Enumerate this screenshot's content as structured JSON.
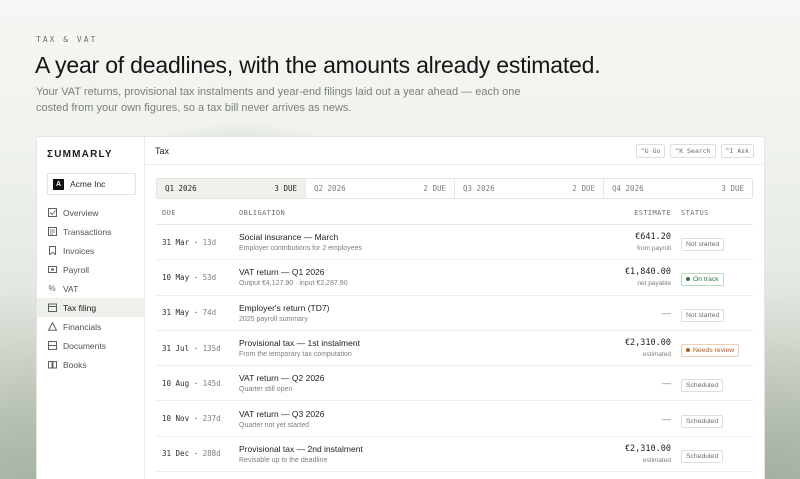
{
  "eyebrow": "TAX & VAT",
  "headline": "A year of deadlines, with the amounts already estimated.",
  "subtitle": "Your VAT returns, provisional tax instalments and year-end filings laid out a year ahead — each one costed from your own figures, so a tax bill never arrives as news.",
  "app": {
    "brand": "ΣUMMARLY",
    "org": {
      "badge": "A",
      "name": "Acme Inc"
    },
    "nav": [
      {
        "label": "Overview",
        "icon": "checkbox-icon"
      },
      {
        "label": "Transactions",
        "icon": "list-icon"
      },
      {
        "label": "Invoices",
        "icon": "bookmark-icon"
      },
      {
        "label": "Payroll",
        "icon": "wallet-icon"
      },
      {
        "label": "VAT",
        "icon": "percent-icon"
      },
      {
        "label": "Tax filing",
        "icon": "calendar-icon",
        "active": true
      },
      {
        "label": "Financials",
        "icon": "triangle-icon"
      },
      {
        "label": "Documents",
        "icon": "stack-icon"
      },
      {
        "label": "Books",
        "icon": "book-icon"
      }
    ],
    "topbar": {
      "title": "Tax",
      "shortcuts": [
        "^G Go",
        "^K Search",
        "^I Ask"
      ]
    },
    "quarters": [
      {
        "label": "Q1 2026",
        "count": "3 DUE",
        "active": true
      },
      {
        "label": "Q2 2026",
        "count": "2 DUE"
      },
      {
        "label": "Q3 2026",
        "count": "2 DUE"
      },
      {
        "label": "Q4 2026",
        "count": "3 DUE"
      }
    ],
    "columns": {
      "due": "DUE",
      "obligation": "OBLIGATION",
      "estimate": "ESTIMATE",
      "status": "STATUS"
    },
    "rows": [
      {
        "due": "31 Mar",
        "days": "13d",
        "title": "Social insurance — March",
        "sub": "Employer contributions for 2 employees",
        "amount": "€641.20",
        "note": "from payroll",
        "status": "Not started",
        "tone": "neutral"
      },
      {
        "due": "10 May",
        "days": "53d",
        "title": "VAT return — Q1 2026",
        "sub": "Output €4,127.90 · input €2,287.90",
        "amount": "€1,840.00",
        "note": "net payable",
        "status": "On track",
        "tone": "green"
      },
      {
        "due": "31 May",
        "days": "74d",
        "title": "Employer's return (TD7)",
        "sub": "2025 payroll summary",
        "amount": "—",
        "note": "",
        "status": "Not started",
        "tone": "neutral"
      },
      {
        "due": "31 Jul",
        "days": "135d",
        "title": "Provisional tax — 1st instalment",
        "sub": "From the temporary tax computation",
        "amount": "€2,310.00",
        "note": "estimated",
        "status": "Needs review",
        "tone": "orange"
      },
      {
        "due": "10 Aug",
        "days": "145d",
        "title": "VAT return — Q2 2026",
        "sub": "Quarter still open",
        "amount": "—",
        "note": "",
        "status": "Scheduled",
        "tone": "neutral"
      },
      {
        "due": "10 Nov",
        "days": "237d",
        "title": "VAT return — Q3 2026",
        "sub": "Quarter not yet started",
        "amount": "—",
        "note": "",
        "status": "Scheduled",
        "tone": "neutral"
      },
      {
        "due": "31 Dec",
        "days": "288d",
        "title": "Provisional tax — 2nd instalment",
        "sub": "Revisable up to the deadline",
        "amount": "€2,310.00",
        "note": "estimated",
        "status": "Scheduled",
        "tone": "neutral"
      }
    ],
    "colors": {
      "on_track": "#2d7a3e",
      "needs_review": "#b45a1f"
    }
  }
}
